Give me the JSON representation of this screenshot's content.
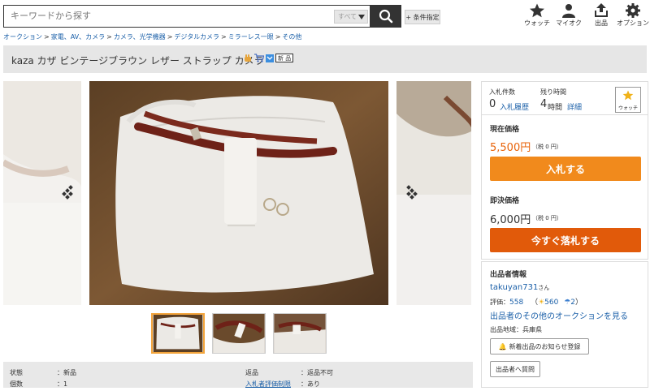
{
  "header": {
    "search_placeholder": "キーワードから探す",
    "category_select": "すべて",
    "cond_button": "+ 条件指定",
    "icons": [
      {
        "name": "star-icon",
        "label": "ウォッチ"
      },
      {
        "name": "person-icon",
        "label": "マイオク"
      },
      {
        "name": "upload-icon",
        "label": "出品"
      },
      {
        "name": "gear-icon",
        "label": "オプション"
      }
    ]
  },
  "breadcrumb": [
    "オークション",
    "家電、AV、カメラ",
    "カメラ、光学機器",
    "デジタルカメラ",
    "ミラーレス一眼",
    "その他"
  ],
  "breadcrumb_sep": ">",
  "title": "kaza カザ ビンテージブラウン レザー ストラップ カメラ",
  "new_badge": "新 品",
  "bid_info": {
    "bids_label": "入札件数",
    "bids_value": "0",
    "bids_link": "入札履歴",
    "time_label": "残り時間",
    "time_value": "4",
    "time_unit": "時間",
    "time_link": "詳細",
    "watch_label": "ウォッチ"
  },
  "current_price": {
    "label": "現在価格",
    "value": "5,500円",
    "tax": "（税 0 円）",
    "button": "入札する"
  },
  "buyout_price": {
    "label": "即決価格",
    "value": "6,000円",
    "tax": "（税 0 円）",
    "button": "今すぐ落札する"
  },
  "seller": {
    "heading": "出品者情報",
    "name": "takuyan731",
    "name_suffix": "さん",
    "rating_label": "評価：",
    "rating_value": "558",
    "good_count": "560",
    "bad_count": "2",
    "other_link": "出品者のその他のオークションを見る",
    "region_label": "出品地域：",
    "region_value": "兵庫県",
    "notify_button": "新着出品のお知らせ登録",
    "question_button": "出品者へ質問"
  },
  "info_table": {
    "row1": {
      "k1": "状態",
      "v1": "：新品",
      "k2": "返品",
      "v2": "：返品不可"
    },
    "row2": {
      "k1": "個数",
      "v1": "：1",
      "k2": "入札者評価制限",
      "v2": "：あり"
    }
  },
  "colors": {
    "accent_orange": "#f39c12",
    "buyout_button": "#e8630a",
    "bid_button": "#f18a1c",
    "price_text": "#e8630a",
    "link": "#1a5fa8"
  }
}
